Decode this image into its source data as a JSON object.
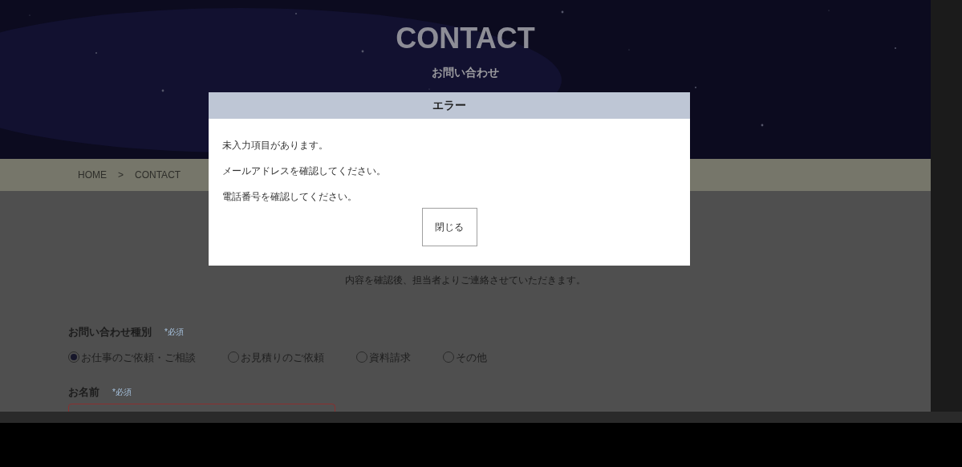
{
  "header": {
    "title": "CONTACT",
    "subtitle": "お問い合わせ"
  },
  "breadcrumb": [
    "HOME",
    ">",
    "CONTACT"
  ],
  "intro": [
    "内容を確認後、担当者よりご連絡させていただきます。"
  ],
  "form": {
    "fields": [
      {
        "kind": "radio",
        "label": "お問い合わせ種別",
        "required": "*必須",
        "options": [
          {
            "label": "お仕事のご依頼・ご相談",
            "selected": true
          },
          {
            "label": "お見積りのご依頼",
            "selected": false
          },
          {
            "label": "資料請求",
            "selected": false
          },
          {
            "label": "その他",
            "selected": false
          }
        ]
      },
      {
        "kind": "text",
        "label": "お名前",
        "required": "*必須",
        "error": true
      }
    ]
  },
  "dialog": {
    "title": "エラー",
    "messages": [
      "未入力項目があります。",
      "メールアドレスを確認してください。",
      "電話番号を確認してください。"
    ],
    "button": "閉じる"
  }
}
